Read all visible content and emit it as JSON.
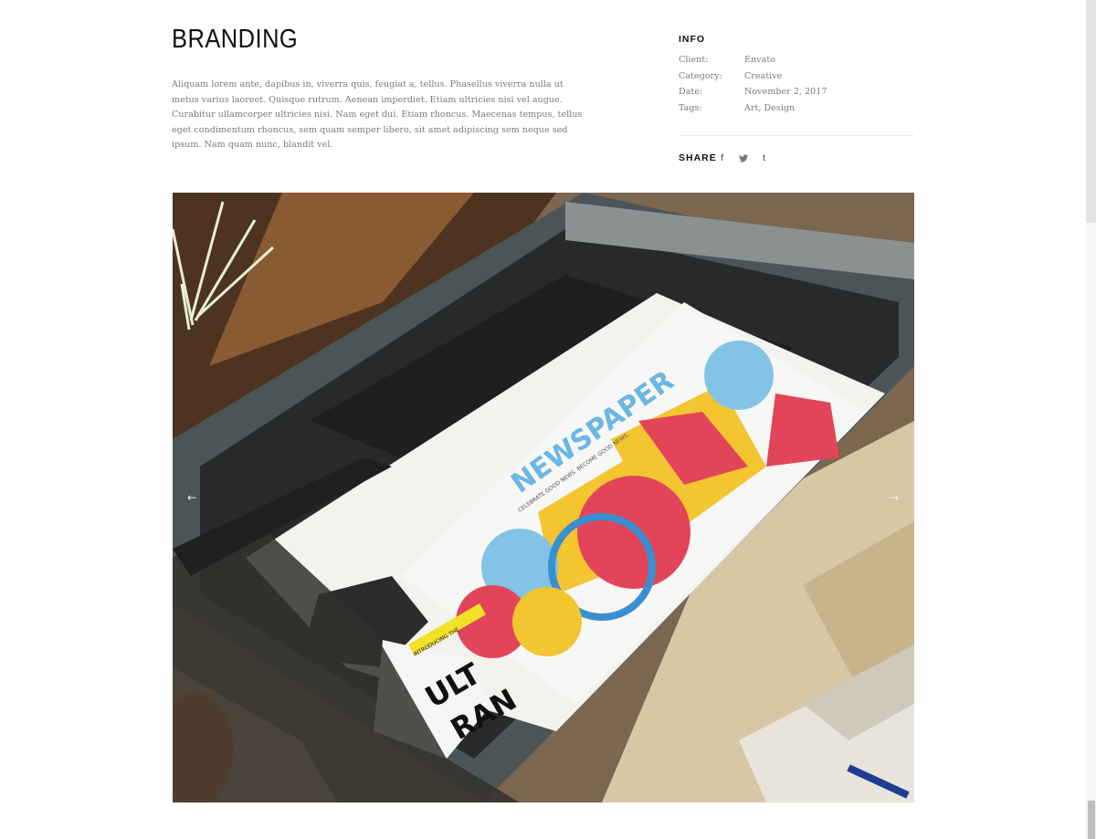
{
  "project": {
    "title": "BRANDING",
    "description": "Aliquam lorem ante, dapibus in, viverra quis, feugiat a, tellus. Phasellus viverra nulla ut metus varius laoreet. Quisque rutrum. Aenean imperdiet. Etiam ultricies nisi vel augue. Curabitur ullamcorper ultricies nisi. Nam eget dui. Etiam rhoncus. Maecenas tempus, tellus eget condimentum rhoncus, sem quam semper libero, sit amet adipiscing sem neque sed ipsum. Nam quam nunc, blandit vel."
  },
  "info": {
    "heading": "INFO",
    "rows": [
      {
        "key": "Client:",
        "value": "Envato"
      },
      {
        "key": "Category:",
        "value": "Creative"
      },
      {
        "key": "Date:",
        "value": "November 2, 2017"
      },
      {
        "key": "Tags:",
        "value": "Art, Design"
      }
    ]
  },
  "share": {
    "label": "SHARE",
    "icons": [
      {
        "name": "facebook-icon",
        "glyph": "f"
      },
      {
        "name": "twitter-icon",
        "glyph": "🐦"
      },
      {
        "name": "tumblr-icon",
        "glyph": "t"
      }
    ]
  },
  "gallery": {
    "prev_arrow": "←",
    "next_arrow": "→",
    "image": {
      "masthead": "NEWSPAPER",
      "tagline": "CELEBRATE GOOD NEWS. BECOME GOOD NEWS.",
      "insert_label": "INTRODUCING THE",
      "insert_big_1": "ULT",
      "insert_big_2": "RAN"
    }
  }
}
